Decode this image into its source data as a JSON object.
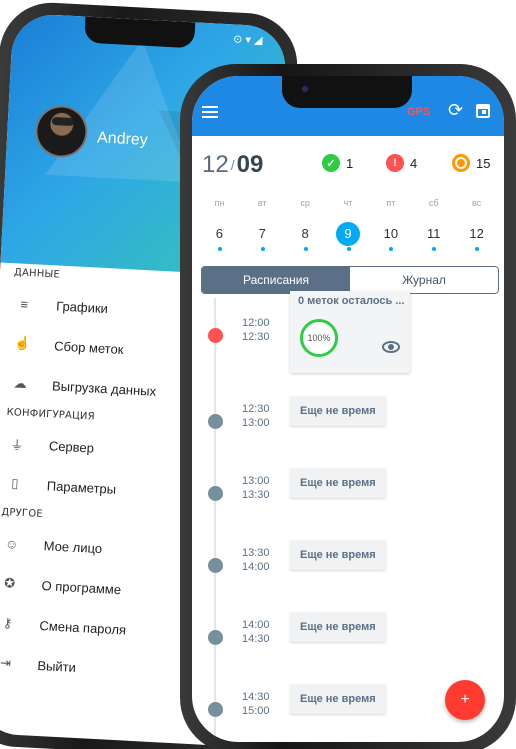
{
  "back_phone": {
    "status_icons": "⊙ ▾ ◢",
    "user_name": "Andrey",
    "sections": [
      {
        "title": "ДАННЫЕ",
        "items": [
          {
            "label": "Графики",
            "icon": "database-icon"
          },
          {
            "label": "Сбор меток",
            "icon": "hand-pointer-icon"
          },
          {
            "label": "Выгрузка данных",
            "icon": "cloud-upload-icon"
          }
        ]
      },
      {
        "title": "КОНФИГУРАЦИЯ",
        "items": [
          {
            "label": "Сервер",
            "icon": "plug-icon"
          },
          {
            "label": "Параметры",
            "icon": "phone-icon"
          }
        ]
      },
      {
        "title": "ДРУГОЕ",
        "items": [
          {
            "label": "Мое лицо",
            "icon": "face-icon"
          },
          {
            "label": "О программе",
            "icon": "star-icon"
          },
          {
            "label": "Смена пароля",
            "icon": "key-icon"
          },
          {
            "label": "Выйти",
            "icon": "logout-icon"
          }
        ]
      }
    ]
  },
  "front_phone": {
    "topbar": {
      "gps_label": "GPS",
      "refresh_icon": "⟳",
      "accent": "#1e88e5"
    },
    "date": {
      "day": "12",
      "sep": "/",
      "month": "09"
    },
    "stats": {
      "done": "1",
      "failed": "4",
      "pending": "15"
    },
    "weekdays": [
      "пн",
      "вт",
      "ср",
      "чт",
      "пт",
      "сб",
      "вс"
    ],
    "days": [
      "6",
      "7",
      "8",
      "9",
      "10",
      "11",
      "12"
    ],
    "selected_day": "9",
    "tabs": {
      "schedule": "Расписания",
      "journal": "Журнал"
    },
    "card": {
      "title": "0 меток осталось ...",
      "from": "12:00",
      "to": "12:30",
      "progress": "100%"
    },
    "slots": [
      {
        "from": "12:30",
        "to": "13:00",
        "label": "Еще не время"
      },
      {
        "from": "13:00",
        "to": "13:30",
        "label": "Еще не время"
      },
      {
        "from": "13:30",
        "to": "14:00",
        "label": "Еще не время"
      },
      {
        "from": "14:00",
        "to": "14:30",
        "label": "Еще не время"
      },
      {
        "from": "14:30",
        "to": "15:00",
        "label": "Еще не время"
      }
    ],
    "fab_label": "+"
  }
}
